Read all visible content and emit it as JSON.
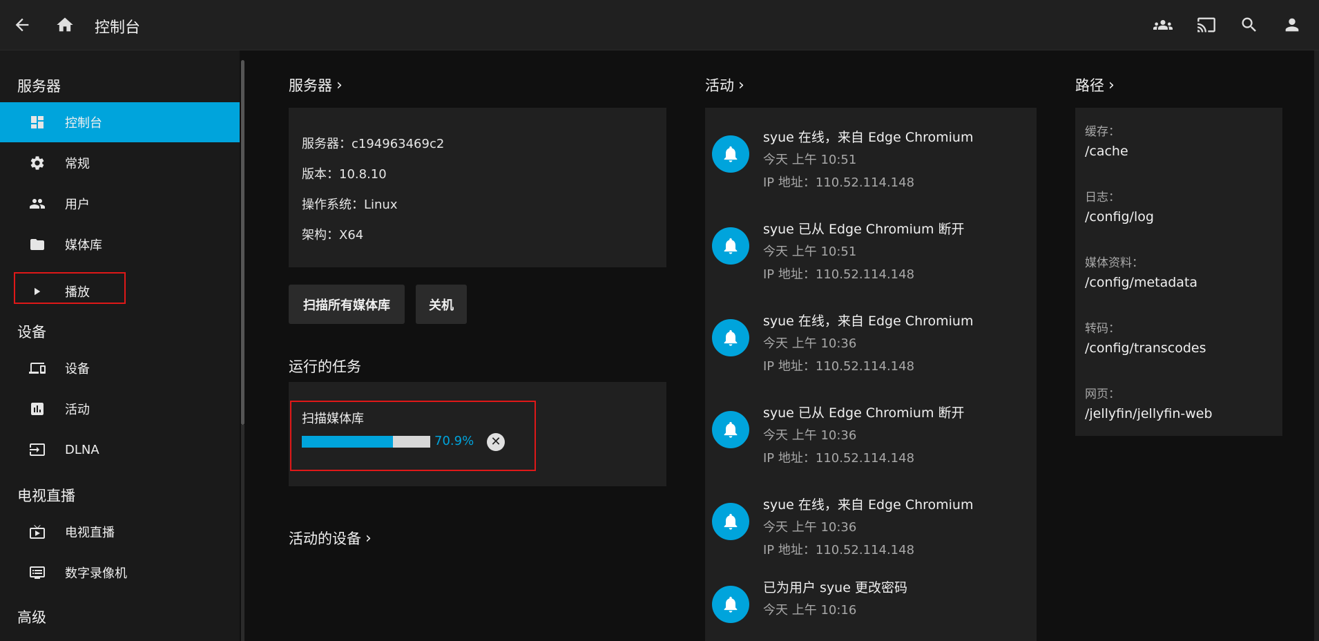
{
  "header": {
    "title": "控制台",
    "icons": [
      "arrow-back-icon",
      "home-icon",
      "users-icon",
      "cast-icon",
      "search-icon",
      "account-icon"
    ]
  },
  "sidebar": {
    "sections": {
      "server": "服务器",
      "devices": "设备",
      "livetv": "电视直播",
      "advanced": "高级"
    },
    "items": [
      {
        "label": "控制台",
        "icon": "dashboard-icon",
        "active": true
      },
      {
        "label": "常规",
        "icon": "gear-icon"
      },
      {
        "label": "用户",
        "icon": "people-icon"
      },
      {
        "label": "媒体库",
        "icon": "folder-icon"
      },
      {
        "label": "播放",
        "icon": "play-icon"
      },
      {
        "label": "设备",
        "icon": "devices-icon"
      },
      {
        "label": "活动",
        "icon": "chart-icon"
      },
      {
        "label": "DLNA",
        "icon": "input-icon"
      },
      {
        "label": "电视直播",
        "icon": "tv-icon"
      },
      {
        "label": "数字录像机",
        "icon": "dvr-icon"
      }
    ]
  },
  "server": {
    "title": "服务器",
    "name": "服务器：c194963469c2",
    "version": "版本：10.8.10",
    "os": "操作系统：Linux",
    "arch": "架构：X64",
    "scan_button": "扫描所有媒体库",
    "shutdown_button": "关机"
  },
  "tasks": {
    "title": "运行的任务",
    "task_name": "扫描媒体库",
    "progress_text": "70.9%",
    "progress_value": 70.9
  },
  "active_devices": {
    "title": "活动的设备"
  },
  "activity": {
    "title": "活动",
    "items": [
      {
        "name": "syue 在线，来自 Edge Chromium",
        "time": "今天 上午 10:51",
        "ip": "IP 地址：110.52.114.148"
      },
      {
        "name": "syue 已从 Edge Chromium 断开",
        "time": "今天 上午 10:51",
        "ip": "IP 地址：110.52.114.148"
      },
      {
        "name": "syue 在线，来自 Edge Chromium",
        "time": "今天 上午 10:36",
        "ip": "IP 地址：110.52.114.148"
      },
      {
        "name": "syue 已从 Edge Chromium 断开",
        "time": "今天 上午 10:36",
        "ip": "IP 地址：110.52.114.148"
      },
      {
        "name": "syue 在线，来自 Edge Chromium",
        "time": "今天 上午 10:36",
        "ip": "IP 地址：110.52.114.148"
      },
      {
        "name": "已为用户 syue 更改密码",
        "time": "今天 上午 10:16",
        "ip": ""
      }
    ]
  },
  "paths": {
    "title": "路径",
    "items": [
      {
        "label": "缓存：",
        "value": "/cache"
      },
      {
        "label": "日志：",
        "value": "/config/log"
      },
      {
        "label": "媒体资料：",
        "value": "/config/metadata"
      },
      {
        "label": "转码：",
        "value": "/config/transcodes"
      },
      {
        "label": "网页：",
        "value": "/jellyfin/jellyfin-web"
      }
    ]
  },
  "colors": {
    "accent": "#00a4dc",
    "highlight_border": "#e01818"
  }
}
